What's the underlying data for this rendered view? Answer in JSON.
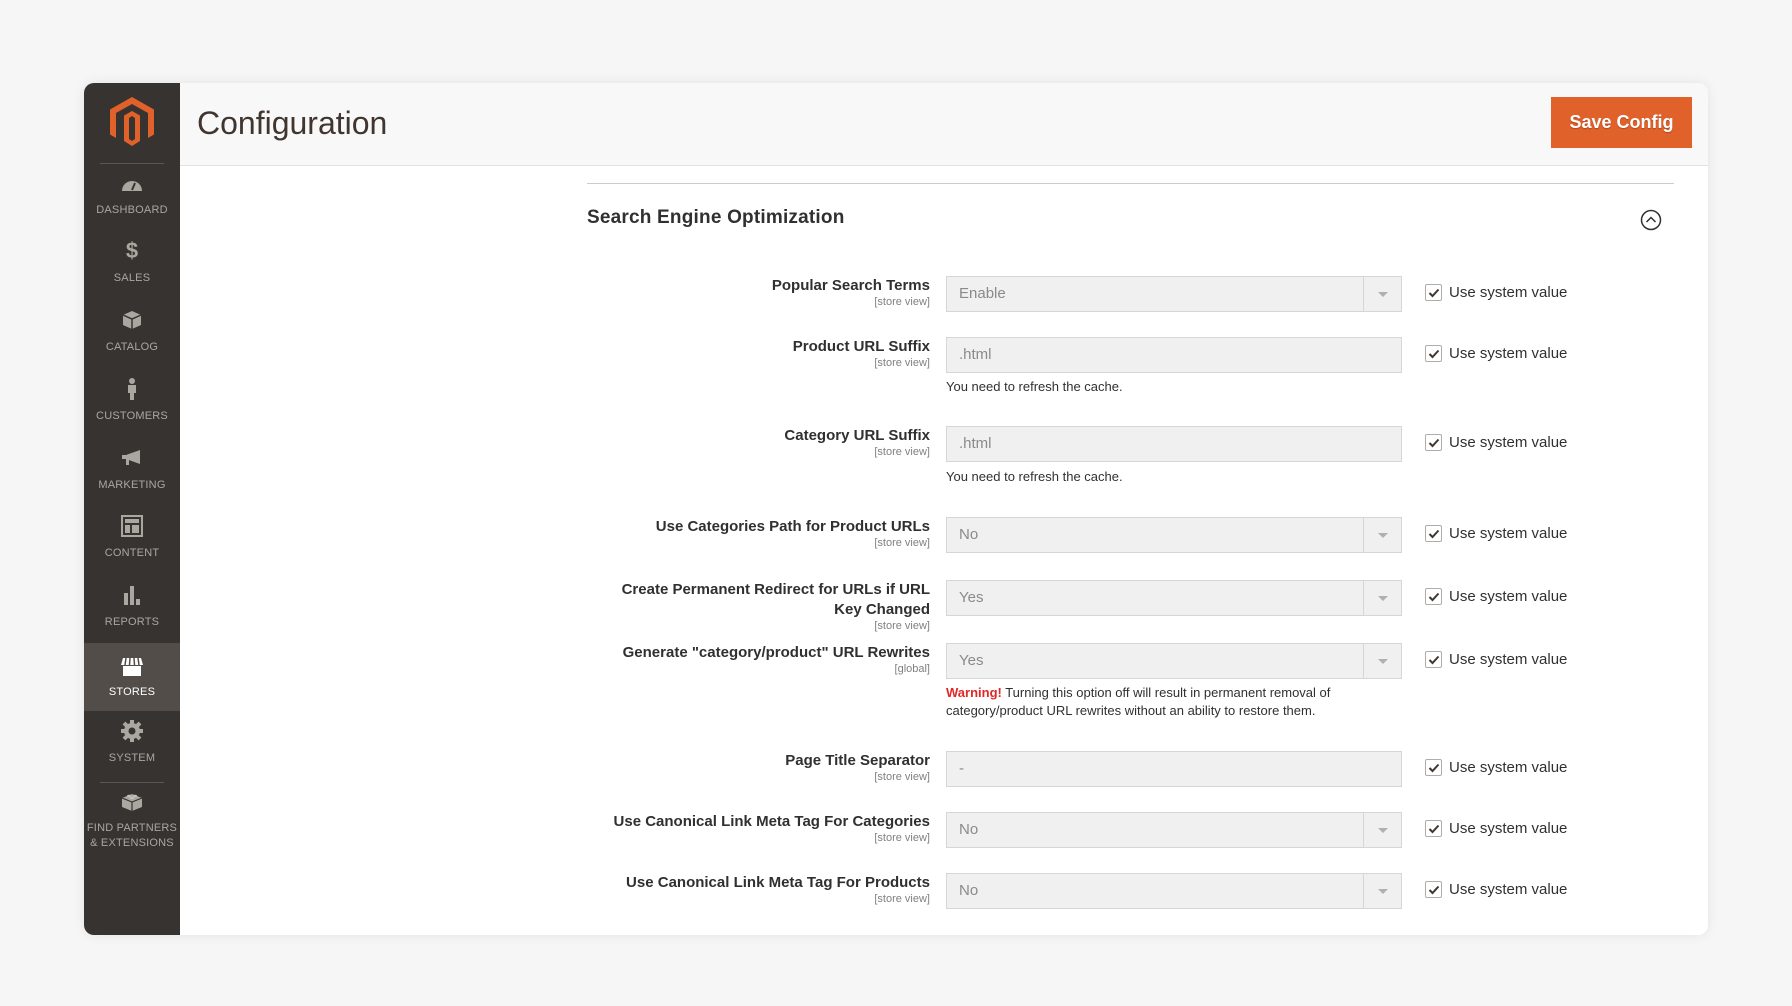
{
  "header": {
    "title": "Configuration",
    "save_label": "Save Config"
  },
  "colors": {
    "accent": "#e0612a",
    "sidebar_bg": "#373330",
    "sidebar_active": "#524d49",
    "warning": "#e22626"
  },
  "sidebar": {
    "items": [
      {
        "label": "DASHBOARD",
        "icon": "dashboard-gauge-icon"
      },
      {
        "label": "SALES",
        "icon": "dollar-icon"
      },
      {
        "label": "CATALOG",
        "icon": "box-icon"
      },
      {
        "label": "CUSTOMERS",
        "icon": "person-icon"
      },
      {
        "label": "MARKETING",
        "icon": "megaphone-icon"
      },
      {
        "label": "CONTENT",
        "icon": "layout-icon"
      },
      {
        "label": "REPORTS",
        "icon": "bar-chart-icon"
      },
      {
        "label": "STORES",
        "icon": "storefront-icon",
        "active": true
      },
      {
        "label": "SYSTEM",
        "icon": "gear-icon"
      },
      {
        "label_line1": "FIND PARTNERS",
        "label_line2": "& EXTENSIONS",
        "icon": "lego-brick-icon"
      }
    ]
  },
  "section": {
    "title": "Search Engine Optimization",
    "rows": [
      {
        "label": "Popular Search Terms",
        "scope": "[store view]",
        "type": "select",
        "value": "Enable",
        "use_system": "Use system value",
        "checked": true
      },
      {
        "label": "Product URL Suffix",
        "scope": "[store view]",
        "type": "text",
        "value": ".html",
        "note": "You need to refresh the cache.",
        "use_system": "Use system value",
        "checked": true
      },
      {
        "label": "Category URL Suffix",
        "scope": "[store view]",
        "type": "text",
        "value": ".html",
        "note": "You need to refresh the cache.",
        "use_system": "Use system value",
        "checked": true
      },
      {
        "label": "Use Categories Path for Product URLs",
        "scope": "[store view]",
        "type": "select",
        "value": "No",
        "use_system": "Use system value",
        "checked": true
      },
      {
        "label_line1": "Create Permanent Redirect for URLs if URL",
        "label_line2": "Key Changed",
        "scope": "[store view]",
        "type": "select",
        "value": "Yes",
        "use_system": "Use system value",
        "checked": true
      },
      {
        "label": "Generate \"category/product\" URL Rewrites",
        "scope": "[global]",
        "type": "select",
        "value": "Yes",
        "warning_strong": "Warning!",
        "warning_text": " Turning this option off will result in permanent removal of category/product URL rewrites without an ability to restore them.",
        "use_system": "Use system value",
        "checked": true
      },
      {
        "label": "Page Title Separator",
        "scope": "[store view]",
        "type": "text",
        "value": "-",
        "use_system": "Use system value",
        "checked": true
      },
      {
        "label": "Use Canonical Link Meta Tag For Categories",
        "scope": "[store view]",
        "type": "select",
        "value": "No",
        "use_system": "Use system value",
        "checked": true
      },
      {
        "label": "Use Canonical Link Meta Tag For Products",
        "scope": "[store view]",
        "type": "select",
        "value": "No",
        "use_system": "Use system value",
        "checked": true
      }
    ]
  }
}
